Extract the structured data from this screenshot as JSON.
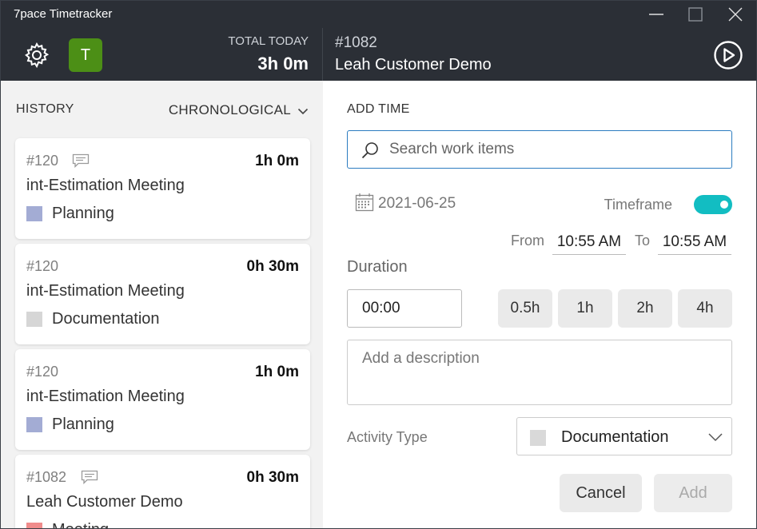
{
  "window": {
    "title": "7pace Timetracker"
  },
  "header": {
    "avatar_initial": "T",
    "total_label": "TOTAL TODAY",
    "total_value": "3h 0m",
    "work_item_id": "#1082",
    "work_item_title": "Leah Customer Demo",
    "avatar_color": "#4c8f16"
  },
  "history": {
    "label": "HISTORY",
    "sort_label": "CHRONOLOGICAL",
    "entries": [
      {
        "id": "#120",
        "has_comment": true,
        "duration": "1h 0m",
        "title": "int-Estimation Meeting",
        "activity": "Planning",
        "activity_color": "#a3acd4"
      },
      {
        "id": "#120",
        "has_comment": false,
        "duration": "0h 30m",
        "title": "int-Estimation Meeting",
        "activity": "Documentation",
        "activity_color": "#d6d6d6"
      },
      {
        "id": "#120",
        "has_comment": false,
        "duration": "1h 0m",
        "title": "int-Estimation Meeting",
        "activity": "Planning",
        "activity_color": "#a3acd4"
      },
      {
        "id": "#1082",
        "has_comment": true,
        "duration": "0h 30m",
        "title": "Leah Customer Demo",
        "activity": "Meeting",
        "activity_color": "#f08c8c"
      }
    ]
  },
  "add_time": {
    "label": "ADD TIME",
    "search_placeholder": "Search work items",
    "date": "2021-06-25",
    "timeframe_label": "Timeframe",
    "timeframe_on": true,
    "from_label": "From",
    "from_value": "10:55 AM",
    "to_label": "To",
    "to_value": "10:55 AM",
    "duration_label": "Duration",
    "duration_value": "00:00",
    "quick_durations": [
      "0.5h",
      "1h",
      "2h",
      "4h"
    ],
    "description_placeholder": "Add a description",
    "activity_type_label": "Activity Type",
    "activity_type_value": "Documentation",
    "cancel_label": "Cancel",
    "add_label": "Add",
    "accent_color": "#12bdc2",
    "focus_color": "#2c7cc0"
  }
}
